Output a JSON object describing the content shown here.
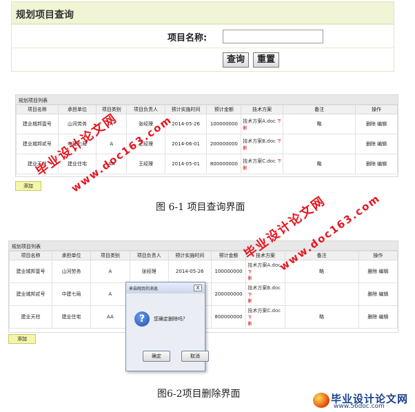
{
  "query": {
    "title": "规划项目查询",
    "name_label": "项目名称:",
    "name_value": "",
    "query_button": "查询",
    "reset_button": "重置"
  },
  "list1": {
    "title": "规划项目列表",
    "headers": [
      "项目名称",
      "承担单位",
      "项目类别",
      "项目负责人",
      "预计实施时间",
      "预计金额",
      "技术方案",
      "备注",
      "操作"
    ],
    "rows": [
      {
        "name": "建业城邦壹号",
        "unit": "山河劳务",
        "type": "A",
        "leader": "张经理",
        "date": "2014-05-26",
        "amount": "100000000",
        "doc": "技术方案A.doc",
        "doc_mark": "下",
        "doc_del": "删",
        "remark": "略",
        "ops": "删除 编辑"
      },
      {
        "name": "建业城邦贰号",
        "unit": "中建七局",
        "type": "A",
        "leader": "王经理",
        "date": "2014-06-01",
        "amount": "200000000",
        "doc": "技术方案B.doc",
        "doc_mark": "下",
        "doc_del": "删",
        "remark": "",
        "ops": "删除 编辑"
      },
      {
        "name": "建业天柱",
        "unit": "建业住宅",
        "type": "AA",
        "leader": "王经理",
        "date": "2014-05-01",
        "amount": "800000000",
        "doc": "技术方案C.doc",
        "doc_mark": "下",
        "doc_del": "删",
        "remark": "略",
        "ops": "删除 编辑"
      }
    ],
    "add_button": "添加"
  },
  "caption1": "图 6-1 项目查询界面",
  "list2": {
    "title": "规划项目列表",
    "headers": [
      "项目名称",
      "承担单位",
      "项目类别",
      "项目负责人",
      "预计实施时间",
      "预计金额",
      "技术方案",
      "备注",
      "操作"
    ],
    "rows": [
      {
        "name": "建业城邦壹号",
        "unit": "山河劳务",
        "type": "A",
        "leader": "张经理",
        "date": "2014-05-26",
        "amount": "100000000",
        "doc": "技术方案A.doc",
        "doc_mark": "下",
        "doc_del": "删",
        "remark": "略",
        "ops": "删除 编辑"
      },
      {
        "name": "建业城邦贰号",
        "unit": "中建七局",
        "type": "A",
        "leader": "",
        "date": "",
        "amount": "200000000",
        "doc": "技术方案B.doc",
        "doc_mark": "下",
        "doc_del": "删",
        "remark": "",
        "ops": "删除 编辑"
      },
      {
        "name": "建业天柱",
        "unit": "建业住宅",
        "type": "AA",
        "leader": "",
        "date": "",
        "amount": "800000000",
        "doc": "技术方案C.doc",
        "doc_mark": "下",
        "doc_del": "删",
        "remark": "略",
        "ops": "删除 编辑"
      }
    ],
    "add_button": "添加"
  },
  "dialog": {
    "title": "来自网页的消息",
    "close": "X",
    "icon": "question-icon",
    "message": "您确定删除吗？",
    "ok": "确定",
    "cancel": "取消"
  },
  "caption2": "图6-2项目删除界面",
  "watermarks": {
    "text1": "毕业设计论文网",
    "text2": "www.doc163.com"
  },
  "logo": {
    "name": "毕业设计论文网",
    "url": "www.56doc.com"
  },
  "colors": {
    "watermark": "#e8141e",
    "query_header_bg": "#f1f5d6",
    "add_button_bg": "#f4f7a8"
  }
}
